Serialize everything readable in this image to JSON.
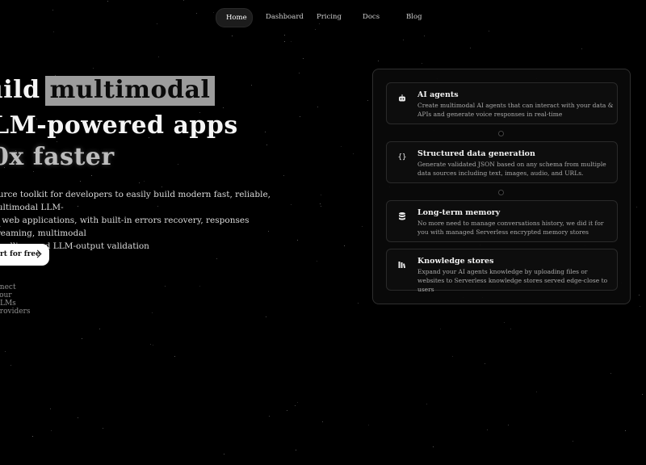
{
  "nav": {
    "items": [
      {
        "label": "Home",
        "active": true
      },
      {
        "label": "Dashboard",
        "active": false
      },
      {
        "label": "Pricing",
        "active": false
      },
      {
        "label": "Docs",
        "active": false
      },
      {
        "label": "Blog",
        "active": false
      }
    ]
  },
  "hero": {
    "line1_prefix": "uild",
    "line1_highlight": "multimodal",
    "line2": "LM-powered apps",
    "line3": "0x faster",
    "description": "source toolkit for developers to easily build modern fast, reliable, Multimodal LLM-ed web applications, with built-in errors recovery, responses streaming, multimodal handling, and LLM-output validation",
    "description_lines": [
      "source toolkit for developers to easily build modern fast, reliable, Multimodal LLM-",
      "ed web applications, with built-in errors recovery, responses streaming, multimodal",
      " handling, and LLM-output validation"
    ],
    "cta_label": "rt for free",
    "connect_text": "nnect your LLMs providers"
  },
  "features": [
    {
      "icon": "robot-icon",
      "title": "AI agents",
      "description": "Create multimodal AI agents that can interact with your data & APIs and generate voice responses in real-time"
    },
    {
      "icon": "code-braces-icon",
      "title": "Structured data generation",
      "description": "Generate validated JSON based on any schema from multiple data sources including text, images, audio, and URLs."
    },
    {
      "icon": "database-icon",
      "title": "Long-term memory",
      "description": "No more need to manage conversations history, we did it for you with managed Serverless encrypted memory stores"
    },
    {
      "icon": "library-icon",
      "title": "Knowledge stores",
      "description": "Expand your AI agents knowledge by uploading files or websites to Serverless knowledge stores served edge-close to users"
    }
  ],
  "colors": {
    "background": "#000000",
    "highlight": "#9c9c9c",
    "card_border": "#2a2a2a"
  }
}
